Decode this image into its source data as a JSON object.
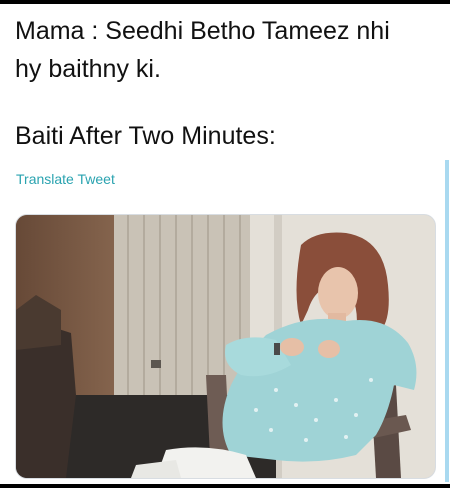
{
  "tweet": {
    "lines": [
      "Mama : Seedhi Betho Tameez nhi",
      "hy baithny ki.",
      "Baiti After Two Minutes:"
    ],
    "translate_label": "Translate Tweet"
  },
  "media": {
    "kind": "photo",
    "subject": "woman-slouching-in-chair"
  },
  "colors": {
    "text": "#111111",
    "link": "#2aa3b0",
    "accent_bar": "#a9d9f0",
    "background": "#ffffff"
  }
}
